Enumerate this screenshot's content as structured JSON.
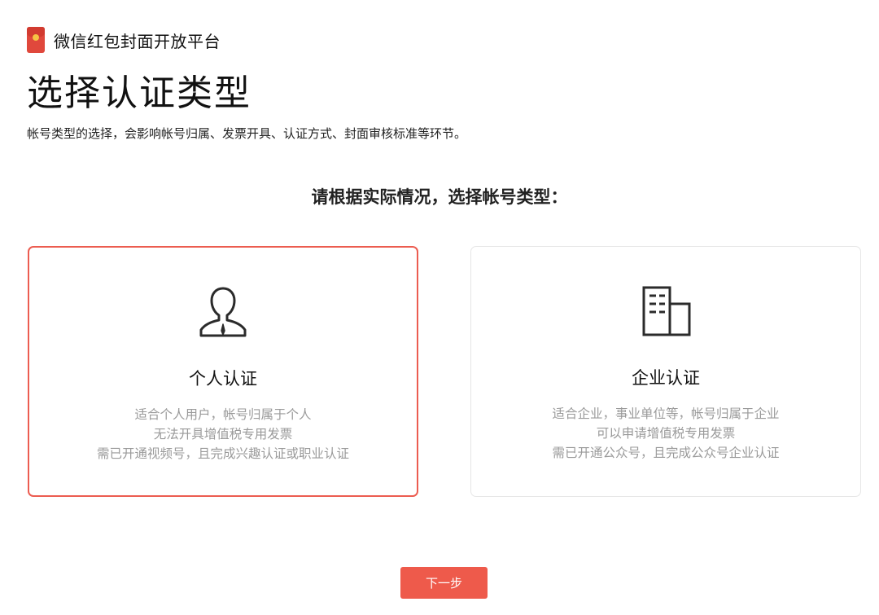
{
  "header": {
    "logo_icon": "red-envelope-icon",
    "app_title": "微信红包封面开放平台"
  },
  "page": {
    "title": "选择认证类型",
    "description": "帐号类型的选择，会影响帐号归属、发票开具、认证方式、封面审核标准等环节。",
    "prompt": "请根据实际情况，选择帐号类型："
  },
  "cards": [
    {
      "icon": "person-icon",
      "title": "个人认证",
      "selected": true,
      "lines": [
        "适合个人用户，帐号归属于个人",
        "无法开具增值税专用发票",
        "需已开通视频号，且完成兴趣认证或职业认证"
      ]
    },
    {
      "icon": "building-icon",
      "title": "企业认证",
      "selected": false,
      "lines": [
        "适合企业，事业单位等，帐号归属于企业",
        "可以申请增值税专用发票",
        "需已开通公众号，且完成公众号企业认证"
      ]
    }
  ],
  "footer": {
    "next_label": "下一步"
  },
  "colors": {
    "accent": "#ee5a4b",
    "selected_border": "#ec5c50",
    "muted_text": "#9a9a9a",
    "card_border": "#e6e6e6"
  }
}
